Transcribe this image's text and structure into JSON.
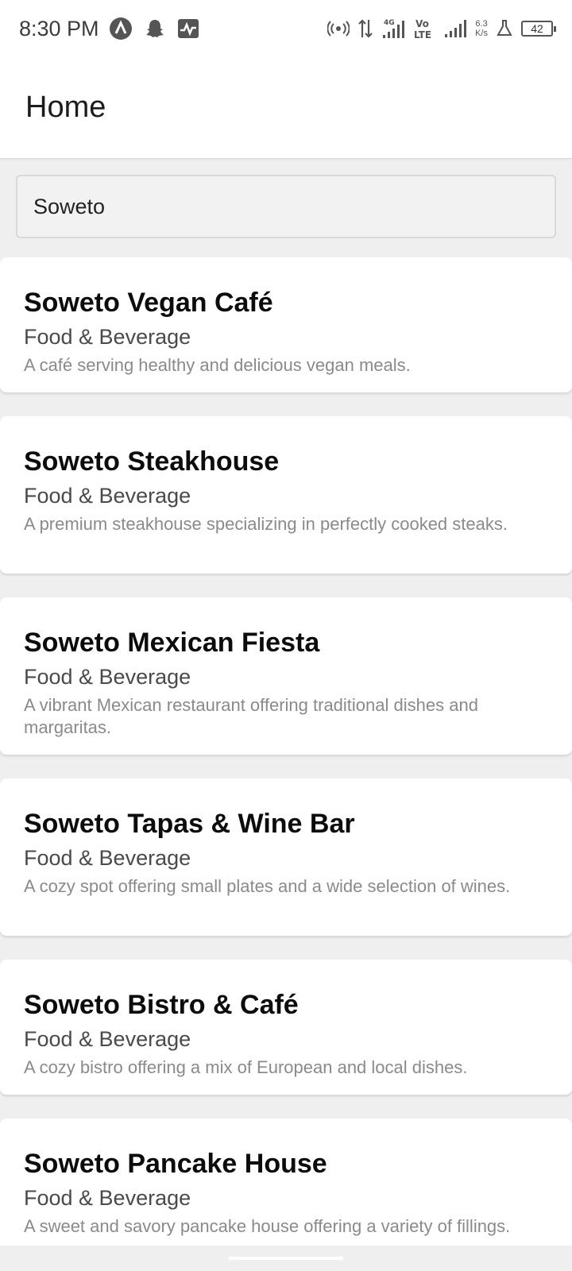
{
  "status_bar": {
    "time": "8:30 PM",
    "net_speed_value": "6.3",
    "net_speed_unit": "K/s",
    "battery": "42",
    "icons": [
      "app-a-icon",
      "snapchat-icon",
      "activity-icon",
      "hotspot-icon",
      "data-arrows-icon",
      "signal-4g-icon",
      "volte-icon",
      "signal-icon",
      "flask-icon",
      "battery-icon"
    ]
  },
  "app_bar": {
    "title": "Home"
  },
  "search": {
    "value": "Soweto",
    "placeholder": ""
  },
  "items": [
    {
      "title": "Soweto Vegan Café",
      "category": "Food & Beverage",
      "description": "A café serving healthy and delicious vegan meals."
    },
    {
      "title": "Soweto Steakhouse",
      "category": "Food & Beverage",
      "description": "A premium steakhouse specializing in perfectly cooked steaks."
    },
    {
      "title": "Soweto Mexican Fiesta",
      "category": "Food & Beverage",
      "description": "A vibrant Mexican restaurant offering traditional dishes and margaritas."
    },
    {
      "title": "Soweto Tapas & Wine Bar",
      "category": "Food & Beverage",
      "description": "A cozy spot offering small plates and a wide selection of wines."
    },
    {
      "title": "Soweto Bistro & Café",
      "category": "Food & Beverage",
      "description": "A cozy bistro offering a mix of European and local dishes."
    },
    {
      "title": "Soweto Pancake House",
      "category": "Food & Beverage",
      "description": "A sweet and savory pancake house offering a variety of fillings."
    }
  ]
}
